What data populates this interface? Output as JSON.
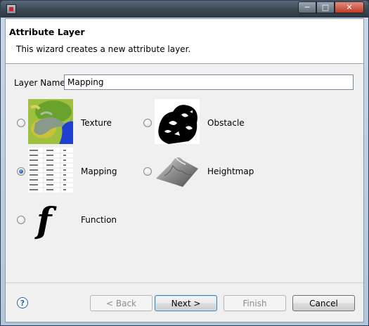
{
  "window": {
    "title": "",
    "controls": {
      "minimize": "─",
      "maximize": "□",
      "close": "✕"
    }
  },
  "banner": {
    "title": "Attribute Layer",
    "description": "This wizard creates a new attribute layer."
  },
  "layer_name": {
    "label": "Layer Name:",
    "value": "Mapping"
  },
  "options": [
    {
      "id": "texture",
      "label": "Texture",
      "selected": false,
      "thumbnail": "texture-map-image"
    },
    {
      "id": "obstacle",
      "label": "Obstacle",
      "selected": false,
      "thumbnail": "obstacle-map-image"
    },
    {
      "id": "mapping",
      "label": "Mapping",
      "selected": true,
      "thumbnail": "mapping-table-image"
    },
    {
      "id": "heightmap",
      "label": "Heightmap",
      "selected": false,
      "thumbnail": "heightmap-surface-image"
    },
    {
      "id": "function",
      "label": "Function",
      "selected": false,
      "thumbnail": "function-f-icon"
    }
  ],
  "buttons": {
    "help": "?",
    "back": "< Back",
    "next": "Next >",
    "finish": "Finish",
    "cancel": "Cancel"
  },
  "colors": {
    "accent": "#1f5fb0",
    "titlebar": "#3f4c58"
  }
}
